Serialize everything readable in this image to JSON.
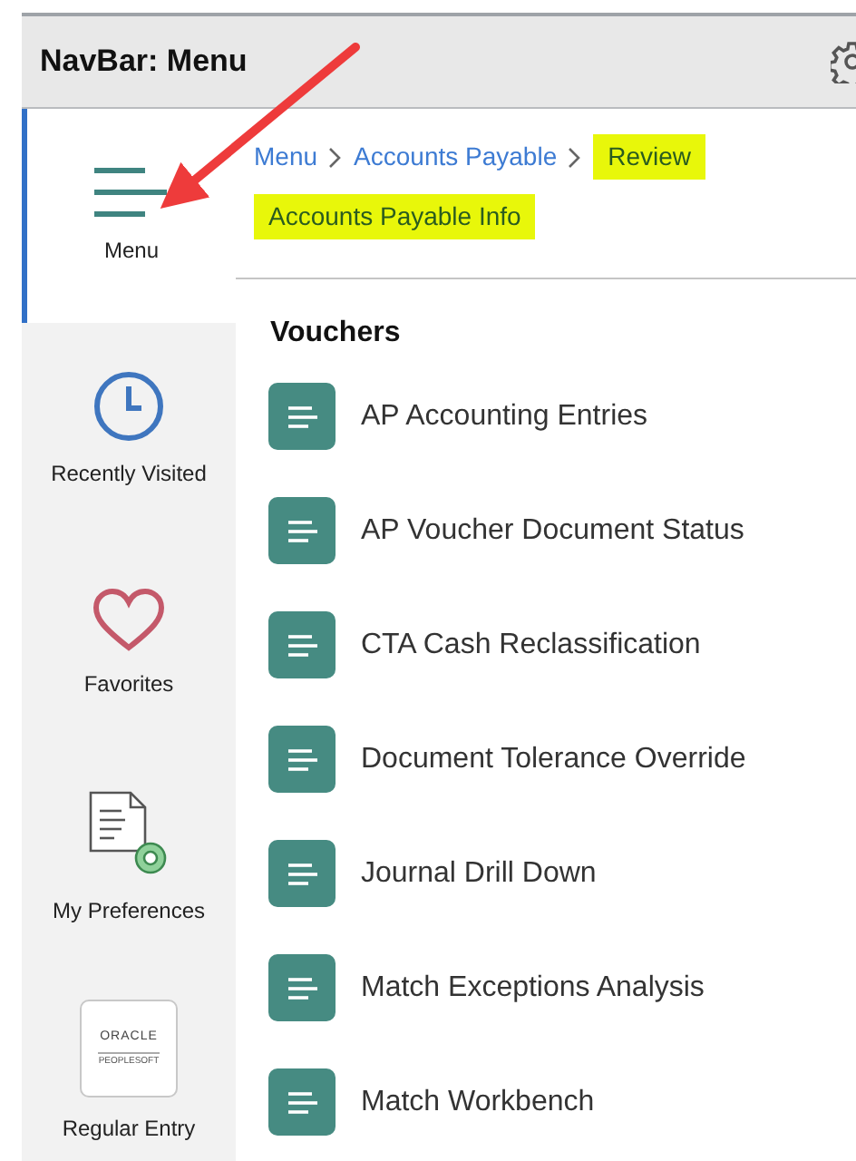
{
  "header": {
    "title": "NavBar: Menu"
  },
  "sidebar": {
    "items": [
      {
        "label": "Menu",
        "kind": "menu",
        "selected": true
      },
      {
        "label": "Recently Visited",
        "kind": "clock",
        "selected": false
      },
      {
        "label": "Favorites",
        "kind": "heart",
        "selected": false
      },
      {
        "label": "My Preferences",
        "kind": "preferences",
        "selected": false
      },
      {
        "label": "Regular Entry",
        "kind": "logo",
        "selected": false,
        "logo_text": [
          "ORACLE",
          "PEOPLESOFT"
        ]
      }
    ]
  },
  "breadcrumbs": [
    {
      "label": "Menu",
      "highlighted": false
    },
    {
      "label": "Accounts Payable",
      "highlighted": false
    },
    {
      "label": "Review",
      "highlighted": true
    },
    {
      "label": "Accounts Payable Info",
      "highlighted": true
    }
  ],
  "section": {
    "title": "Vouchers",
    "items": [
      "AP Accounting Entries",
      "AP Voucher Document Status",
      "CTA Cash Reclassification",
      "Document Tolerance Override",
      "Journal Drill Down",
      "Match Exceptions Analysis",
      "Match Workbench"
    ]
  }
}
